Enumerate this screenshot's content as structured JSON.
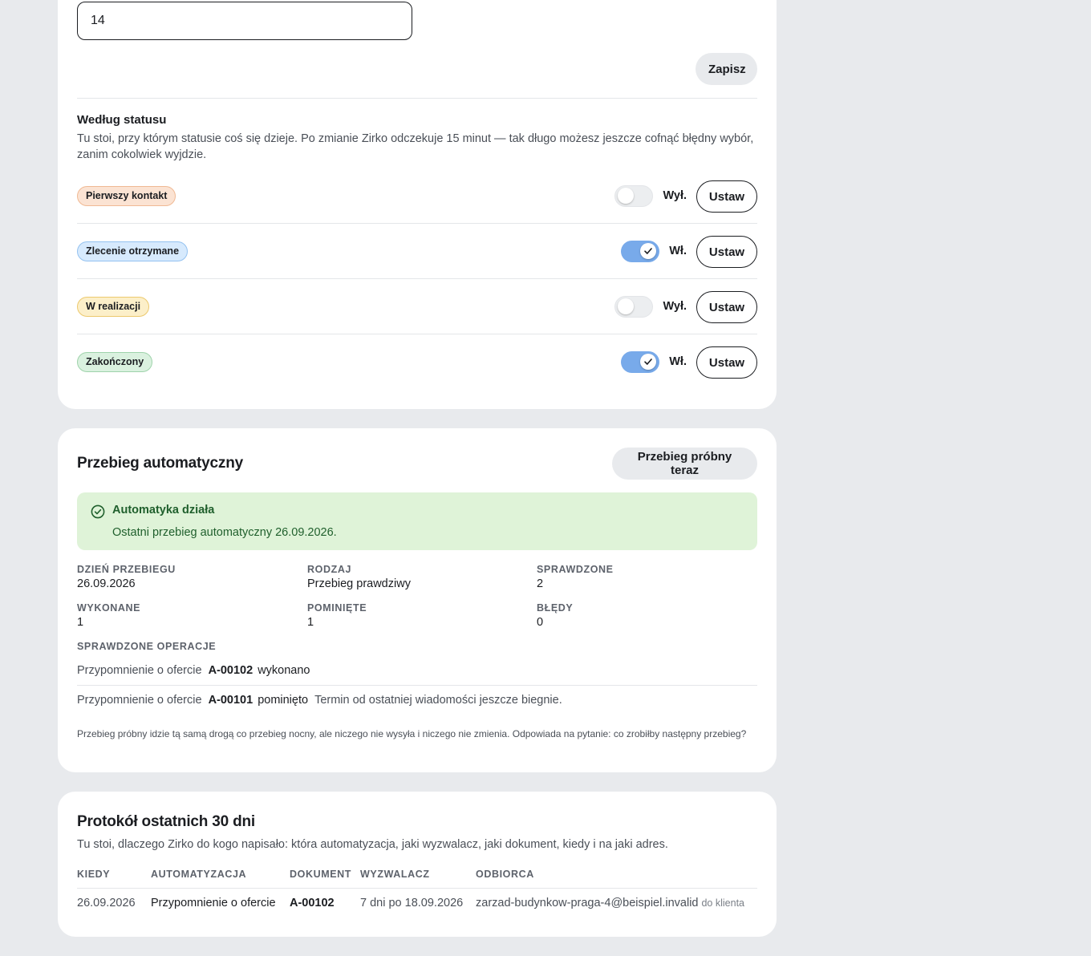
{
  "settings": {
    "days_value": "14",
    "save_label": "Zapisz",
    "by_status": {
      "title": "Według statusu",
      "description": "Tu stoi, przy którym statusie coś się dzieje. Po zmianie Zirko odczekuje 15 minut — tak długo możesz jeszcze cofnąć błędny wybór, zanim cokolwiek wyjdzie.",
      "rows": [
        {
          "badge": "Pierwszy kontakt",
          "state": "Wył.",
          "on": false,
          "action": "Ustaw",
          "bg": "#fbe3d3",
          "border": "#f0b994"
        },
        {
          "badge": "Zlecenie otrzymane",
          "state": "Wł.",
          "on": true,
          "action": "Ustaw",
          "bg": "#d7eafd",
          "border": "#94c2f0"
        },
        {
          "badge": "W realizacji",
          "state": "Wył.",
          "on": false,
          "action": "Ustaw",
          "bg": "#fcefc9",
          "border": "#ecc96e"
        },
        {
          "badge": "Zakończony",
          "state": "Wł.",
          "on": true,
          "action": "Ustaw",
          "bg": "#daf1df",
          "border": "#9fd3ab"
        }
      ]
    }
  },
  "auto_run": {
    "title": "Przebieg automatyczny",
    "test_button": "Przebieg próbny teraz",
    "alert": {
      "title": "Automatyka działa",
      "text": "Ostatni przebieg automatyczny 26.09.2026."
    },
    "stats": {
      "day_label": "Dzień przebiegu",
      "day_value": "26.09.2026",
      "kind_label": "Rodzaj",
      "kind_value": "Przebieg prawdziwy",
      "checked_label": "Sprawdzone",
      "checked_value": "2",
      "done_label": "Wykonane",
      "done_value": "1",
      "skipped_label": "Pominięte",
      "skipped_value": "1",
      "errors_label": "Błędy",
      "errors_value": "0"
    },
    "ops_label": "Sprawdzone operacje",
    "ops": [
      {
        "name": "Przypomnienie o ofercie",
        "code": "A-00102",
        "status": "wykonano",
        "note": ""
      },
      {
        "name": "Przypomnienie o ofercie",
        "code": "A-00101",
        "status": "pominięto",
        "note": "Termin od ostatniej wiadomości jeszcze biegnie."
      }
    ],
    "footnote": "Przebieg próbny idzie tą samą drogą co przebieg nocny, ale niczego nie wysyła i niczego nie zmienia. Odpowiada na pytanie: co zrobiłby następny przebieg?"
  },
  "log": {
    "title": "Protokół ostatnich 30 dni",
    "description": "Tu stoi, dlaczego Zirko do kogo napisało: która automatyzacja, jaki wyzwalacz, jaki dokument, kiedy i na jaki adres.",
    "columns": [
      "Kiedy",
      "Automatyzacja",
      "Dokument",
      "Wyzwalacz",
      "Odbiorca"
    ],
    "rows": [
      {
        "when": "26.09.2026",
        "automation": "Przypomnienie o ofercie",
        "document": "A-00102",
        "trigger": "7 dni po 18.09.2026",
        "recipient": "zarzad-budynkow-praga-4@beispiel.invalid",
        "recipient_note": "do klienta"
      }
    ]
  }
}
